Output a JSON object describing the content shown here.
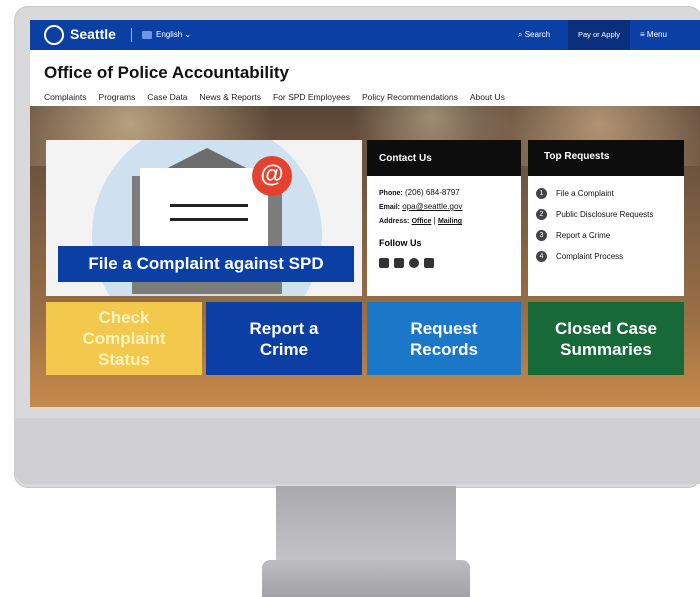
{
  "topbar": {
    "logo_text": "Seattle",
    "language": "English",
    "search_label": "Search",
    "pay_label": "Pay or Apply",
    "menu_label": "Menu"
  },
  "site": {
    "title": "Office of Police Accountability"
  },
  "nav": {
    "items": [
      "Complaints",
      "Programs",
      "Case Data",
      "News & Reports",
      "For SPD Employees",
      "Policy Recommendations",
      "About Us"
    ]
  },
  "hero": {
    "icon_char": "@",
    "banner": "File a Complaint against SPD"
  },
  "contact": {
    "heading": "Contact Us",
    "phone_label": "Phone:",
    "phone": "(206) 684-8797",
    "email_label": "Email:",
    "email": "opa@seattle.gov",
    "address_label": "Address:",
    "address_office": "Office",
    "address_sep": "|",
    "address_mailing": "Mailing",
    "follow_heading": "Follow Us",
    "social_icons": [
      "facebook-icon",
      "twitter-icon",
      "wordpress-icon",
      "email-icon"
    ]
  },
  "requests": {
    "heading": "Top Requests",
    "items": [
      {
        "num": "1",
        "label": "File a Complaint"
      },
      {
        "num": "2",
        "label": "Public Disclosure Requests"
      },
      {
        "num": "3",
        "label": "Report a Crime"
      },
      {
        "num": "4",
        "label": "Complaint Process"
      }
    ]
  },
  "tiles": [
    {
      "label": "Check Complaint Status",
      "color": "#f2c94c"
    },
    {
      "label": "Report a Crime",
      "color": "#0c3fa4"
    },
    {
      "label": "Request Records",
      "color": "#1b77c7"
    },
    {
      "label": "Closed Case Summaries",
      "color": "#17693a"
    }
  ]
}
